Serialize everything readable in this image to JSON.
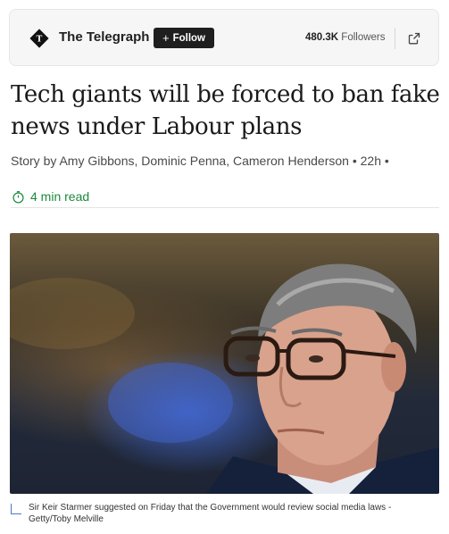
{
  "publisher": {
    "name": "The Telegraph",
    "follow_label": "Follow",
    "follow_plus": "+",
    "followers_count": "480.3K",
    "followers_label": "Followers",
    "logo_icon": "telegraph-logo-icon",
    "share_icon": "external-link-icon"
  },
  "article": {
    "headline": "Tech giants will be forced to ban fake news under Labour plans",
    "byline": "Story by Amy Gibbons, Dominic Penna, Cameron Henderson • 22h •",
    "read_time": "4 min read",
    "image_caption": "Sir Keir Starmer suggested on Friday that the Government would review social media laws - Getty/Toby Melville"
  },
  "colors": {
    "accent_green": "#1b8a3c",
    "follow_button": "#1f1f1f",
    "caption_accent": "#4a79c9"
  }
}
